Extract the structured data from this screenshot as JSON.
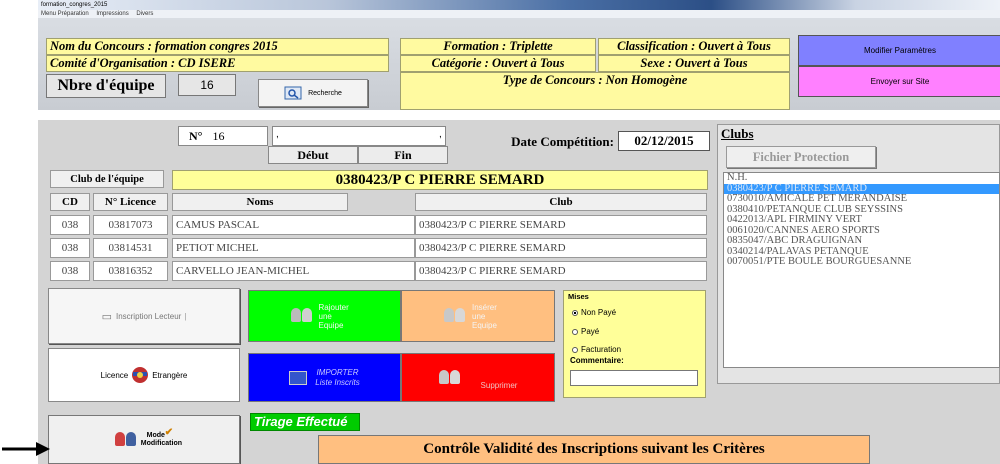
{
  "window": {
    "title": "formation_congres_2015"
  },
  "menu": {
    "items": [
      "Menu Préparation",
      "Impressions",
      "Divers"
    ]
  },
  "concours": {
    "nom": "Nom du Concours : formation  congres  2015",
    "comite": "Comité d'Organisation : CD ISERE",
    "formation": "Formation : Triplette",
    "categorie": "Catégorie : Ouvert à Tous",
    "classification": "Classification : Ouvert à Tous",
    "sexe": "Sexe : Ouvert à Tous",
    "type": "Type de Concours : Non Homogène",
    "nbre_label": "Nbre d'équipe",
    "nbre_value": "16"
  },
  "buttons": {
    "recherche": "Recherche",
    "modifier": "Modifier Paramètres",
    "envoyer": "Envoyer sur Site",
    "debut": "Début",
    "fin": "Fin",
    "inscription_lecteur": "Inscription Lecteur",
    "rajouter": "Rajouter une Equipe",
    "inserer": "Insérer une Equipe",
    "licence": "Licence",
    "etrangere": "Etrangère",
    "importer": "IMPORTER",
    "liste_inscrits": "Liste Inscrits",
    "supprimer": "Supprimer",
    "mode_modification": "Mode Modification",
    "fichier_protection": "Fichier Protection",
    "controle": "Contrôle Validité des Inscriptions suivant les Critères"
  },
  "equipe": {
    "numero_label": "N°",
    "numero_value": "16",
    "date_label": "Date Compétition:",
    "date_value": "02/12/2015",
    "club_label": "Club de l'équipe",
    "club_value": "0380423/P C PIERRE SEMARD"
  },
  "joueurs": {
    "headers": {
      "cd": "CD",
      "licence": "N° Licence",
      "noms": "Noms",
      "club": "Club"
    },
    "rows": [
      {
        "cd": "038",
        "licence": "03817073",
        "nom": "CAMUS PASCAL",
        "club": "0380423/P C PIERRE SEMARD"
      },
      {
        "cd": "038",
        "licence": "03814531",
        "nom": "PETIOT MICHEL",
        "club": "0380423/P C PIERRE SEMARD"
      },
      {
        "cd": "038",
        "licence": "03816352",
        "nom": "CARVELLO JEAN-MICHEL",
        "club": "0380423/P C PIERRE SEMARD"
      }
    ]
  },
  "mises": {
    "title": "Mises",
    "options": [
      "Non Payé",
      "Payé",
      "Facturation"
    ],
    "selected": "Non Payé",
    "commentaire_label": "Commentaire:",
    "commentaire_value": ""
  },
  "tirage": "Tirage Effectué",
  "clubs": {
    "title": "Clubs",
    "items": [
      "N.H.",
      "0380423/P C PIERRE SEMARD",
      "0730010/AMICALE PET MERANDAISE",
      "0380410/PETANQUE CLUB SEYSSINS",
      "0422013/APL FIRMINY VERT",
      "0061020/CANNES AERO SPORTS",
      "0835047/ABC DRAGUIGNAN",
      "0340214/PALAVAS PETANQUE",
      "0070051/PTE BOULE BOURGUESANNE"
    ],
    "selected_index": 1
  },
  "colors": {
    "modifier_btn": "#8080ff",
    "envoyer_btn": "#ff80ff",
    "rajouter_btn": "#00ff00",
    "inserer_btn": "#ffbf80",
    "importer_btn": "#0000ff",
    "supprimer_btn": "#ff0000",
    "highlight_yellow": "#ffff99",
    "tirage_bg": "#00cc00",
    "controle_bg": "#ffbf80"
  }
}
